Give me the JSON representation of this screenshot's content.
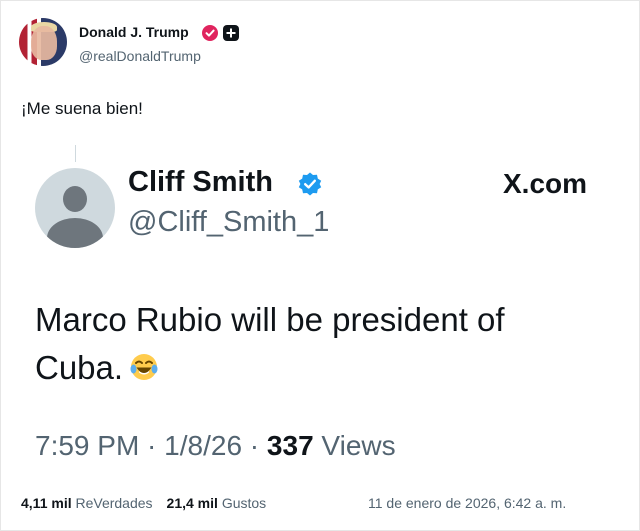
{
  "post": {
    "author_name": "Donald J. Trump",
    "author_handle": "@realDonaldTrump",
    "text": "¡Me suena bien!",
    "stats": {
      "reposts_count": "4,11 mil",
      "reposts_label": "ReVerdades",
      "likes_count": "21,4 mil",
      "likes_label": "Gustos"
    },
    "date": "11 de enero de 2026, 6:42 a. m."
  },
  "quote": {
    "name": "Cliff Smith",
    "handle": "@Cliff_Smith_1",
    "source": "X.com",
    "text": "Marco Rubio will be president of Cuba.",
    "emoji": "face-with-tears-of-joy",
    "time": "7:59 PM",
    "date": "1/8/26",
    "views_count": "337",
    "views_label": "Views"
  },
  "colors": {
    "verified_pink": "#e0245e",
    "verified_blue": "#1d9bf0",
    "secondary_text": "#536471",
    "primary_text": "#0f1419"
  },
  "icons": [
    "verified-badge-icon",
    "plus-badge-icon",
    "default-avatar-icon",
    "laugh-emoji-icon"
  ]
}
